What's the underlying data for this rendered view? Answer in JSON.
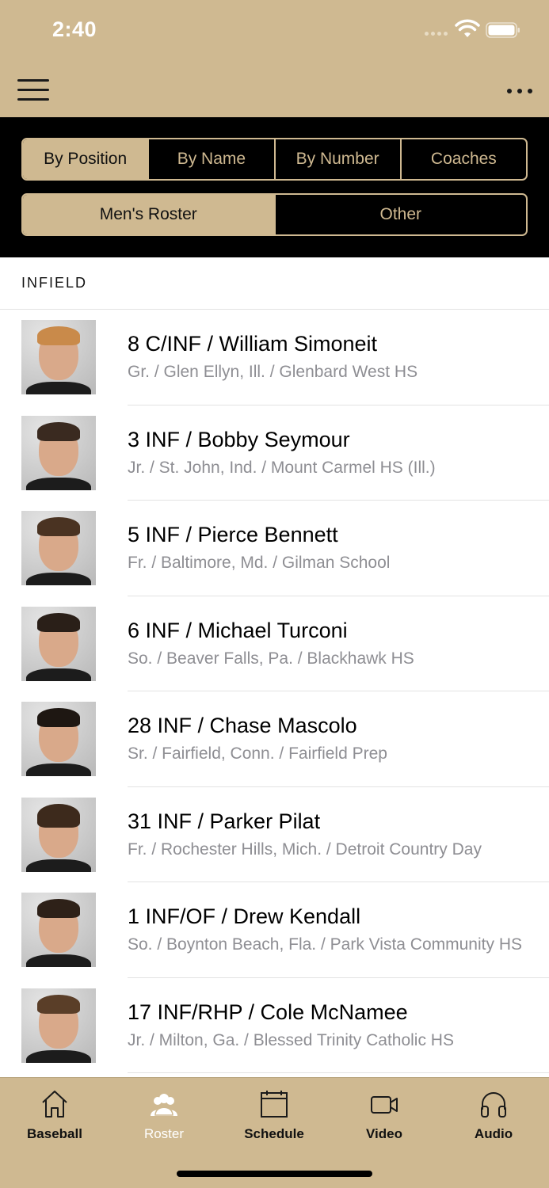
{
  "status": {
    "time": "2:40"
  },
  "tabs_primary": [
    {
      "label": "By Position",
      "active": true
    },
    {
      "label": "By Name",
      "active": false
    },
    {
      "label": "By Number",
      "active": false
    },
    {
      "label": "Coaches",
      "active": false
    }
  ],
  "tabs_secondary": [
    {
      "label": "Men's Roster",
      "active": true
    },
    {
      "label": "Other",
      "active": false
    }
  ],
  "section": {
    "title": "INFIELD"
  },
  "players": [
    {
      "title": "8 C/INF / William Simoneit",
      "subtitle": "Gr. / Glen Ellyn, Ill. / Glenbard West HS"
    },
    {
      "title": "3 INF / Bobby Seymour",
      "subtitle": "Jr. / St. John, Ind. / Mount Carmel HS (Ill.)"
    },
    {
      "title": "5 INF / Pierce Bennett",
      "subtitle": "Fr. / Baltimore, Md. / Gilman School"
    },
    {
      "title": "6 INF / Michael Turconi",
      "subtitle": "So. / Beaver Falls, Pa. / Blackhawk HS"
    },
    {
      "title": "28 INF / Chase Mascolo",
      "subtitle": "Sr. / Fairfield, Conn. / Fairfield Prep"
    },
    {
      "title": "31 INF / Parker Pilat",
      "subtitle": "Fr. / Rochester Hills, Mich. / Detroit Country Day"
    },
    {
      "title": "1 INF/OF / Drew Kendall",
      "subtitle": "So. / Boynton Beach, Fla. / Park Vista Community HS"
    },
    {
      "title": "17 INF/RHP / Cole McNamee",
      "subtitle": "Jr. / Milton, Ga. / Blessed Trinity Catholic HS"
    }
  ],
  "tab_bar": [
    {
      "label": "Baseball",
      "icon": "home-icon",
      "active": false
    },
    {
      "label": "Roster",
      "icon": "people-icon",
      "active": true
    },
    {
      "label": "Schedule",
      "icon": "calendar-icon",
      "active": false
    },
    {
      "label": "Video",
      "icon": "video-camera-icon",
      "active": false
    },
    {
      "label": "Audio",
      "icon": "headphones-icon",
      "active": false
    }
  ],
  "colors": {
    "gold": "#cfb991",
    "black": "#000000",
    "subtitle_gray": "#8e8e93"
  }
}
